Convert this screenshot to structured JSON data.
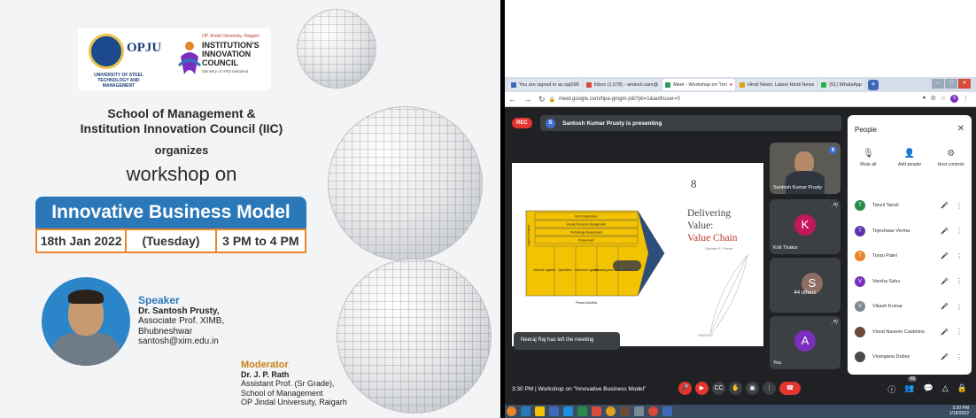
{
  "poster": {
    "opju_logo": "OPJU",
    "opju_sub": "UNIVERSITY OF STEEL TECHNOLOGY AND MANAGEMENT",
    "iic_small": "OP Jindal University, Raigarh",
    "iic_title": "INSTITUTION'S INNOVATION COUNCIL",
    "iic_sub": "(Ministry of HRD Initiative)",
    "school_line1": "School of Management &",
    "school_line2": "Institution Innovation Council (IIC)",
    "organizes": "organizes",
    "workshop": "workshop on",
    "title": "Innovative Business Model",
    "date": "18th Jan 2022",
    "day": "(Tuesday)",
    "time": "3 PM to 4 PM",
    "speaker_heading": "Speaker",
    "speaker_name": "Dr. Santosh Prusty,",
    "speaker_role": "Associate Prof. XIMB,",
    "speaker_city": "Bhubneshwar",
    "speaker_email": "santosh@xim.edu.in",
    "moderator_heading": "Moderator",
    "moderator_name": "Dr. J. P. Rath",
    "moderator_role": "Assistant Prof. (Sr Grade),",
    "moderator_school": "School of Management",
    "moderator_univ": "OP Jindal Universuty, Raigarh"
  },
  "browser": {
    "tabs": [
      {
        "label": "You are signed in as opj098",
        "color": "#3e68b8"
      },
      {
        "label": "Inbox (1,578) - amlesh.sam@",
        "color": "#d64b3b"
      },
      {
        "label": "Meet - Workshop on \"Inn",
        "color": "#2a9d5c"
      },
      {
        "label": "Hindi News: Latest Hindi News",
        "color": "#e0a020"
      },
      {
        "label": "(51) WhatsApp",
        "color": "#25b04a"
      }
    ],
    "url": "meet.google.com/hpa-gmgm-job?pli=1&authuser=0"
  },
  "meet": {
    "rec": "REC",
    "presenter_initial": "S",
    "presenting": "Santosh Kumar Prusty is presenting",
    "slide": {
      "number": "8",
      "title1": "Delivering",
      "title2": "Value:",
      "title3": "Value Chain",
      "author": "- Michael E. Porter",
      "footer": "SMSSRS",
      "support_label": "Support Activities",
      "rows": [
        "Firm Infrastructure",
        "Human Resource Management",
        "Technology Development",
        "Procurement"
      ],
      "primary": [
        "Inbound Logistics",
        "Operations",
        "Outbound Logistics",
        "Marketing and Sales",
        "Service"
      ],
      "primary_label": "Primary Activities",
      "margin": "Margin"
    },
    "toast": "Neeraj Raj has left the meeting",
    "tiles": {
      "video_name": "Santosh Kumar Prusty",
      "k_initial": "K",
      "k_name": "Kriti Thakur",
      "others_initial": "S",
      "others": "44 others",
      "a_initial": "A",
      "a_name": "You"
    },
    "people": {
      "title": "People",
      "mute_all": "Mute all",
      "add_people": "Add people",
      "host_controls": "Host controls",
      "list": [
        {
          "initial": "T",
          "name": "Tanzil Tanzil",
          "color": "#2a8a4a"
        },
        {
          "initial": "T",
          "name": "Tejeshwar Verma",
          "color": "#5b35b0"
        },
        {
          "initial": "T",
          "name": "Toran Patel",
          "color": "#e8862e"
        },
        {
          "initial": "V",
          "name": "Varsha Sahu",
          "color": "#7b2fbe"
        },
        {
          "initial": "V",
          "name": "Vikash Kumar",
          "color": "#7c8a96"
        },
        {
          "initial": "",
          "name": "Vinod Naveen Castelino",
          "color": "#6b4a3a"
        },
        {
          "initial": "",
          "name": "Virangana Dubey",
          "color": "#4a4a4a"
        }
      ]
    },
    "bottom": {
      "time_title": "3:30 PM  |  Workshop on \"Innovative Business Model\"",
      "people_count": "48"
    },
    "clock_time": "3:30 PM",
    "clock_date": "1/18/2022"
  }
}
